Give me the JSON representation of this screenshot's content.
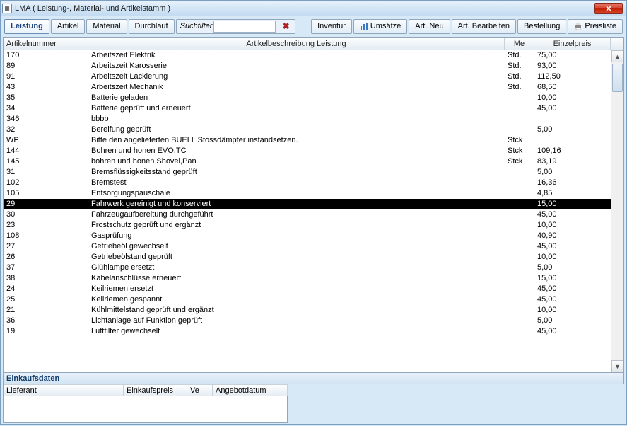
{
  "window": {
    "title": "LMA  ( Leistung-, Material- und Artikelstamm )"
  },
  "tabs": {
    "leistung": "Leistung",
    "artikel": "Artikel",
    "material": "Material",
    "durchlauf": "Durchlauf"
  },
  "suchfilter": {
    "label": "Suchfilter",
    "value": ""
  },
  "toolbar": {
    "inventur": "Inventur",
    "umsaetze": "Umsätze",
    "art_neu": "Art. Neu",
    "art_bearbeiten": "Art. Bearbeiten",
    "bestellung": "Bestellung",
    "preisliste": "Preisliste"
  },
  "columns": {
    "artikelnummer": "Artikelnummer",
    "beschreibung": "Artikelbeschreibung Leistung",
    "me": "Me",
    "einzelpreis": "Einzelpreis"
  },
  "rows": [
    {
      "nr": "170",
      "beschr": "Arbeitszeit Elektrik",
      "me": "Std.",
      "preis": "75,00",
      "sel": false
    },
    {
      "nr": "89",
      "beschr": "Arbeitszeit Karosserie",
      "me": "Std.",
      "preis": "93,00",
      "sel": false
    },
    {
      "nr": "91",
      "beschr": "Arbeitszeit Lackierung",
      "me": "Std.",
      "preis": "112,50",
      "sel": false
    },
    {
      "nr": "43",
      "beschr": "Arbeitszeit Mechanik",
      "me": "Std.",
      "preis": "68,50",
      "sel": false
    },
    {
      "nr": "35",
      "beschr": "Batterie geladen",
      "me": "",
      "preis": "10,00",
      "sel": false
    },
    {
      "nr": "34",
      "beschr": "Batterie geprüft und erneuert",
      "me": "",
      "preis": "45,00",
      "sel": false
    },
    {
      "nr": "346",
      "beschr": "bbbb",
      "me": "",
      "preis": "",
      "sel": false
    },
    {
      "nr": "32",
      "beschr": "Bereifung geprüft",
      "me": "",
      "preis": "5,00",
      "sel": false
    },
    {
      "nr": "WP",
      "beschr": "Bitte den angelieferten BUELL Stossdämpfer instandsetzen.",
      "me": "Stck",
      "preis": "",
      "sel": false
    },
    {
      "nr": "144",
      "beschr": "Bohren und honen EVO,TC",
      "me": "Stck",
      "preis": "109,16",
      "sel": false
    },
    {
      "nr": "145",
      "beschr": "bohren und honen Shovel,Pan",
      "me": "Stck",
      "preis": "83,19",
      "sel": false
    },
    {
      "nr": "31",
      "beschr": "Bremsflüssigkeitsstand geprüft",
      "me": "",
      "preis": "5,00",
      "sel": false
    },
    {
      "nr": "102",
      "beschr": "Bremstest",
      "me": "",
      "preis": "16,36",
      "sel": false
    },
    {
      "nr": "105",
      "beschr": "Entsorgungspauschale",
      "me": "",
      "preis": "4,85",
      "sel": false
    },
    {
      "nr": "29",
      "beschr": "Fahrwerk gereinigt und konserviert",
      "me": "",
      "preis": "15,00",
      "sel": true
    },
    {
      "nr": "30",
      "beschr": "Fahrzeugaufbereitung durchgeführt",
      "me": "",
      "preis": "45,00",
      "sel": false
    },
    {
      "nr": "23",
      "beschr": "Frostschutz geprüft und ergänzt",
      "me": "",
      "preis": "10,00",
      "sel": false
    },
    {
      "nr": "108",
      "beschr": "Gasprüfung",
      "me": "",
      "preis": "40,90",
      "sel": false
    },
    {
      "nr": "27",
      "beschr": "Getriebeöl gewechselt",
      "me": "",
      "preis": "45,00",
      "sel": false
    },
    {
      "nr": "26",
      "beschr": "Getriebeölstand geprüft",
      "me": "",
      "preis": "10,00",
      "sel": false
    },
    {
      "nr": "37",
      "beschr": "Glühlampe ersetzt",
      "me": "",
      "preis": "5,00",
      "sel": false
    },
    {
      "nr": "38",
      "beschr": "Kabelanschlüsse erneuert",
      "me": "",
      "preis": "15,00",
      "sel": false
    },
    {
      "nr": "24",
      "beschr": "Keilriemen ersetzt",
      "me": "",
      "preis": "45,00",
      "sel": false
    },
    {
      "nr": "25",
      "beschr": "Keilriemen gespannt",
      "me": "",
      "preis": "45,00",
      "sel": false
    },
    {
      "nr": "21",
      "beschr": "Kühlmittelstand geprüft und ergänzt",
      "me": "",
      "preis": "10,00",
      "sel": false
    },
    {
      "nr": "36",
      "beschr": "Lichtanlage auf Funktion geprüft",
      "me": "",
      "preis": "5,00",
      "sel": false
    },
    {
      "nr": "19",
      "beschr": "Luftfilter gewechselt",
      "me": "",
      "preis": "45,00",
      "sel": false
    }
  ],
  "einkauf": {
    "title": "Einkaufsdaten",
    "cols": {
      "lieferant": "Lieferant",
      "einkaufspreis": "Einkaufspreis",
      "ve": "Ve",
      "angebotdatum": "Angebotdatum"
    }
  }
}
